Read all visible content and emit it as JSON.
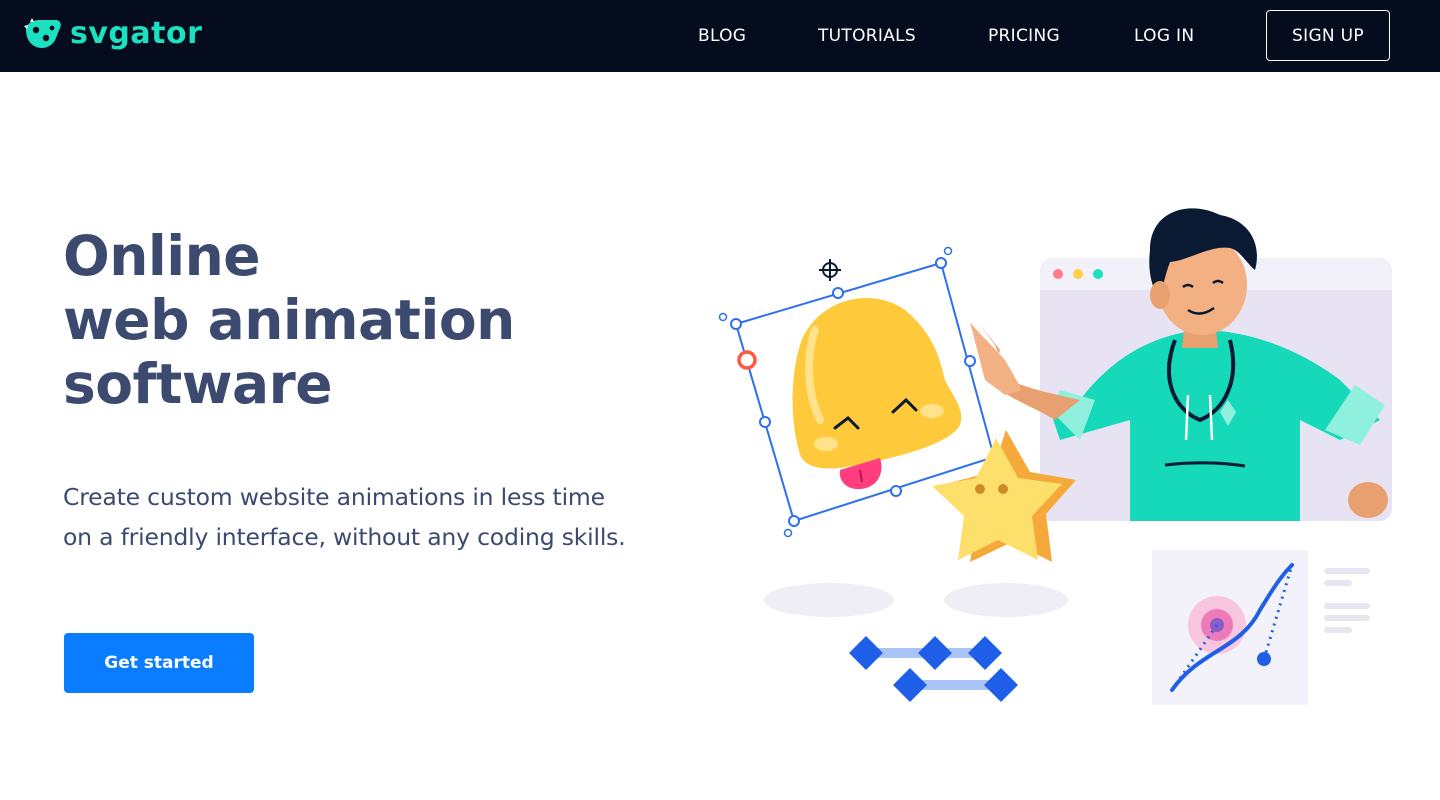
{
  "brand": {
    "name": "svgator",
    "accent": "#1ce0bf",
    "header_bg": "#050c1e"
  },
  "nav": {
    "blog": "BLOG",
    "tutorials": "TUTORIALS",
    "pricing": "PRICING",
    "login": "LOG IN",
    "signup": "SIGN UP"
  },
  "hero": {
    "headline_line1": "Online",
    "headline_line2": "web animation",
    "headline_line3": "software",
    "subtitle": "Create custom website animations in less time on a friendly interface, without any coding skills.",
    "cta_label": "Get started",
    "cta_color": "#0a7cff",
    "text_color": "#3b4a6e"
  },
  "illustration": {
    "elements": [
      "bell-icon",
      "star-icon",
      "character",
      "browser-window",
      "motion-path-panel",
      "keyframe-timeline"
    ]
  }
}
